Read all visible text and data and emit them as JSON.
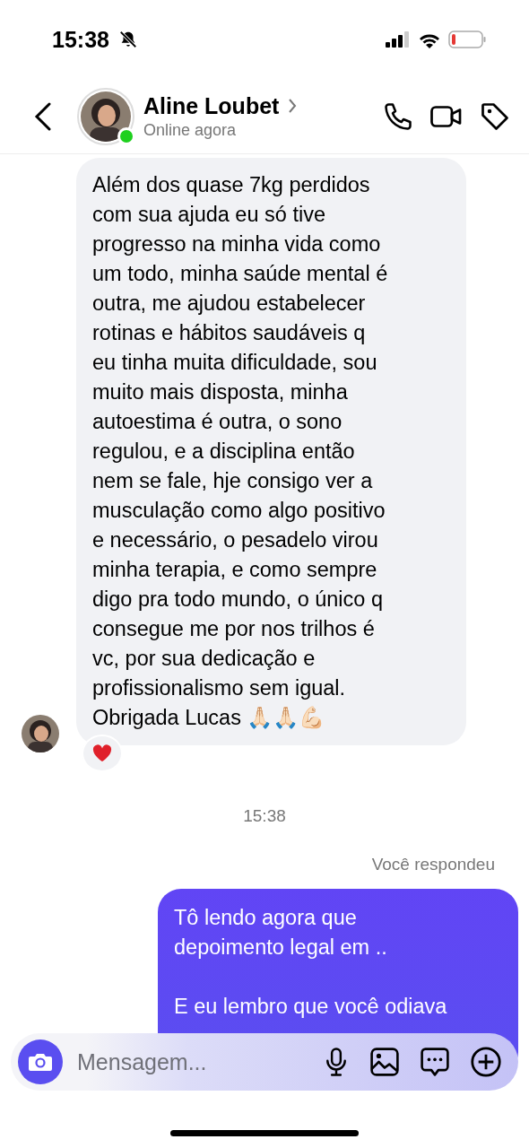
{
  "status_bar": {
    "time": "15:38",
    "silent": true
  },
  "header": {
    "name": "Aline Loubet",
    "status": "Online agora",
    "online": true
  },
  "messages": [
    {
      "kind": "received",
      "text": "Além dos quase 7kg perdidos\ncom sua ajuda eu só tive\nprogresso na minha vida como\num todo, minha saúde mental é\noutra, me ajudou estabelecer\nrotinas e hábitos saudáveis q\neu tinha muita dificuldade, sou\nmuito mais disposta, minha\nautoestima é outra, o sono\nregulou, e a disciplina então\nnem se fale, hje consigo ver a\nmusculação como algo positivo\ne necessário, o pesadelo virou\nminha terapia, e como sempre\ndigo pra todo mundo, o único q\nconsegue me por nos trilhos é\nvc, por sua dedicação e\nprofissionalismo sem igual.\nObrigada Lucas 🙏🏻🙏🏻💪🏻",
      "reaction": true
    },
    {
      "kind": "time",
      "text": "15:38"
    },
    {
      "kind": "note",
      "text": "Você respondeu"
    },
    {
      "kind": "sent",
      "text": "Tô lendo agora que\ndepoimento legal em ..\n\nE eu lembro que você odiava"
    }
  ],
  "composer": {
    "placeholder": "Mensagem..."
  }
}
